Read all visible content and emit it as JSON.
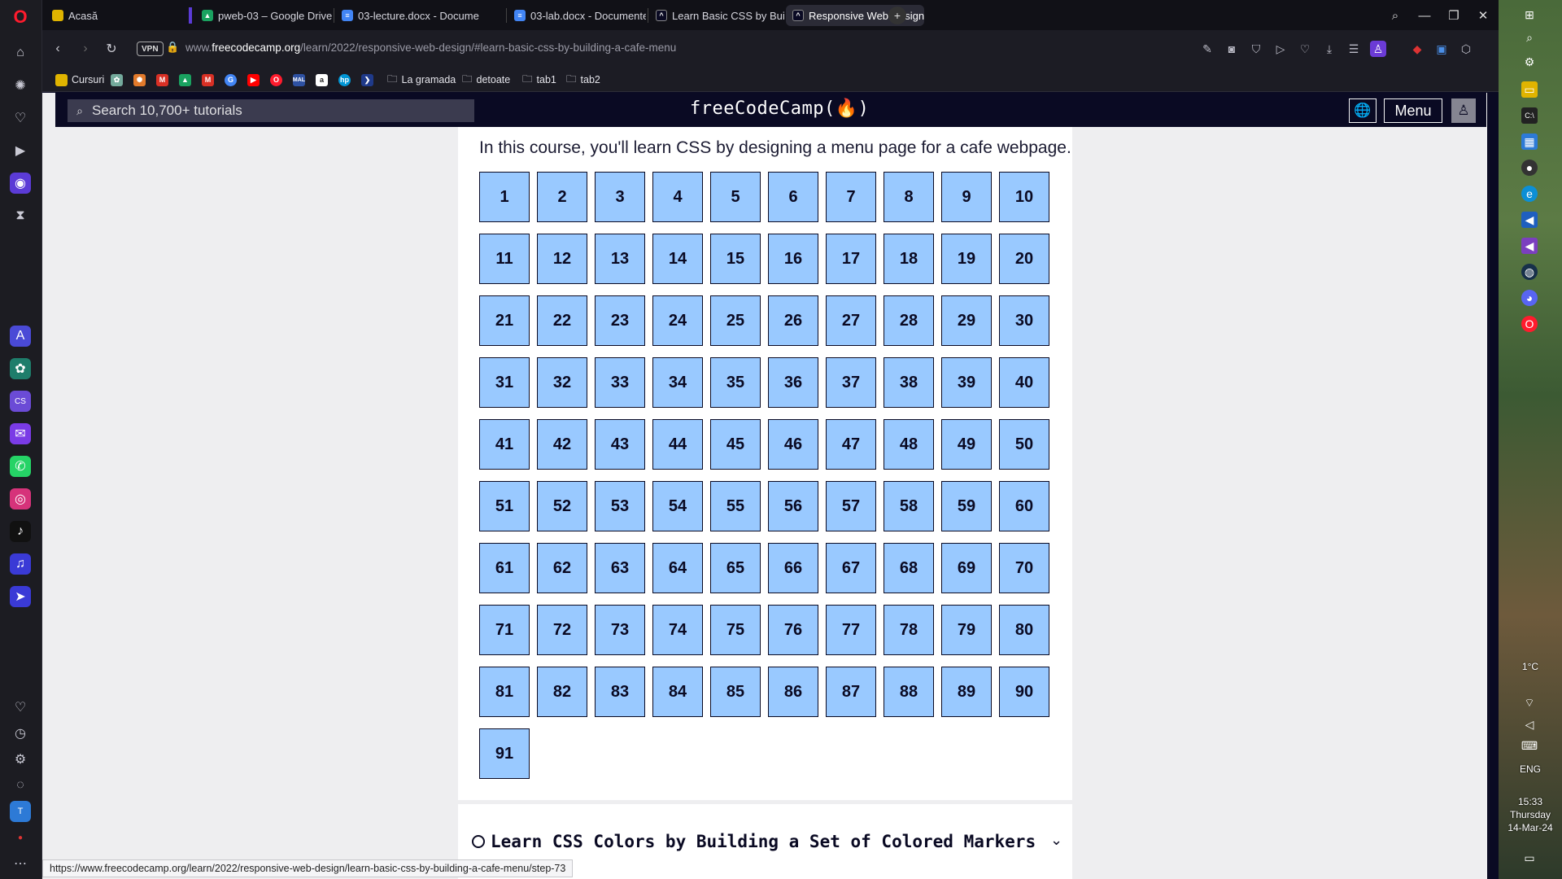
{
  "browser": {
    "tabs": [
      {
        "title": "Acasă",
        "favicon": "photo-icon",
        "color": "#e0b400"
      },
      {
        "title": "pweb-03 – Google Drive",
        "favicon": "google-drive-icon",
        "color": "#1aa260"
      },
      {
        "title": "03-lecture.docx - Docume",
        "favicon": "docs-icon",
        "color": "#4285f4"
      },
      {
        "title": "03-lab.docx - Documente",
        "favicon": "docs-icon",
        "color": "#4285f4"
      },
      {
        "title": "Learn Basic CSS by Buildin",
        "favicon": "fcc-icon",
        "color": "#0a0a23"
      },
      {
        "title": "Responsive Web Design C",
        "favicon": "fcc-icon",
        "color": "#0a0a23"
      }
    ],
    "new_tab_label": "+",
    "url_prefix": "www.",
    "url_domain": "freecodecamp.org",
    "url_path": "/learn/2022/responsive-web-design/#learn-basic-css-by-building-a-cafe-menu",
    "vpn_label": "VPN",
    "bookmarks": [
      {
        "label": "Cursuri",
        "icon": "folder-icon",
        "color": "#e0b400"
      },
      {
        "label": "",
        "icon": "chatgpt-icon",
        "color": "#74aa9c"
      },
      {
        "label": "",
        "icon": "flower-icon",
        "color": "#e27a2b"
      },
      {
        "label": "",
        "icon": "gmail-icon",
        "color": "#d93025"
      },
      {
        "label": "",
        "icon": "drive-icon",
        "color": "#1aa260"
      },
      {
        "label": "",
        "icon": "gmail-icon",
        "color": "#d93025"
      },
      {
        "label": "",
        "icon": "google-icon",
        "color": "#4285f4"
      },
      {
        "label": "",
        "icon": "youtube-icon",
        "color": "#ff0000"
      },
      {
        "label": "",
        "icon": "opera-icon",
        "color": "#ff1b2d"
      },
      {
        "label": "",
        "icon": "mal-icon",
        "color": "#2e51a2"
      },
      {
        "label": "",
        "icon": "amazon-icon",
        "color": "#222"
      },
      {
        "label": "",
        "icon": "hp-icon",
        "color": "#0096d6"
      },
      {
        "label": "",
        "icon": "powershell-icon",
        "color": "#1f3a8a"
      },
      {
        "label": "La gramada",
        "icon": "folder-icon",
        "color": "#cfcfd6"
      },
      {
        "label": "detoate",
        "icon": "folder-icon",
        "color": "#cfcfd6"
      },
      {
        "label": "tab1",
        "icon": "folder-icon",
        "color": "#cfcfd6"
      },
      {
        "label": "tab2",
        "icon": "folder-icon",
        "color": "#cfcfd6"
      }
    ]
  },
  "fcc": {
    "search_placeholder": "Search 10,700+ tutorials",
    "logo_text": "freeCodeCamp(🔥)",
    "menu_label": "Menu",
    "intro_text": "In this course, you'll learn CSS by designing a menu page for a cafe webpage.",
    "steps": [
      "1",
      "2",
      "3",
      "4",
      "5",
      "6",
      "7",
      "8",
      "9",
      "10",
      "11",
      "12",
      "13",
      "14",
      "15",
      "16",
      "17",
      "18",
      "19",
      "20",
      "21",
      "22",
      "23",
      "24",
      "25",
      "26",
      "27",
      "28",
      "29",
      "30",
      "31",
      "32",
      "33",
      "34",
      "35",
      "36",
      "37",
      "38",
      "39",
      "40",
      "41",
      "42",
      "43",
      "44",
      "45",
      "46",
      "47",
      "48",
      "49",
      "50",
      "51",
      "52",
      "53",
      "54",
      "55",
      "56",
      "57",
      "58",
      "59",
      "60",
      "61",
      "62",
      "63",
      "64",
      "65",
      "66",
      "67",
      "68",
      "69",
      "70",
      "71",
      "72",
      "73",
      "74",
      "75",
      "76",
      "77",
      "78",
      "79",
      "80",
      "81",
      "82",
      "83",
      "84",
      "85",
      "86",
      "87",
      "88",
      "89",
      "90",
      "91"
    ],
    "next_course_title": "Learn CSS Colors by Building a Set of Colored Markers",
    "status_url": "https://www.freecodecamp.org/learn/2022/responsive-web-design/learn-basic-css-by-building-a-cafe-menu/step-73"
  },
  "tray": {
    "weather": "1°C",
    "lang": "ENG",
    "time": "15:33",
    "day": "Thursday",
    "date": "14-Mar-24"
  },
  "colors": {
    "step_bg": "#99c9ff",
    "nav_bg": "#0a0a23",
    "accent": "#ff1b2d"
  }
}
